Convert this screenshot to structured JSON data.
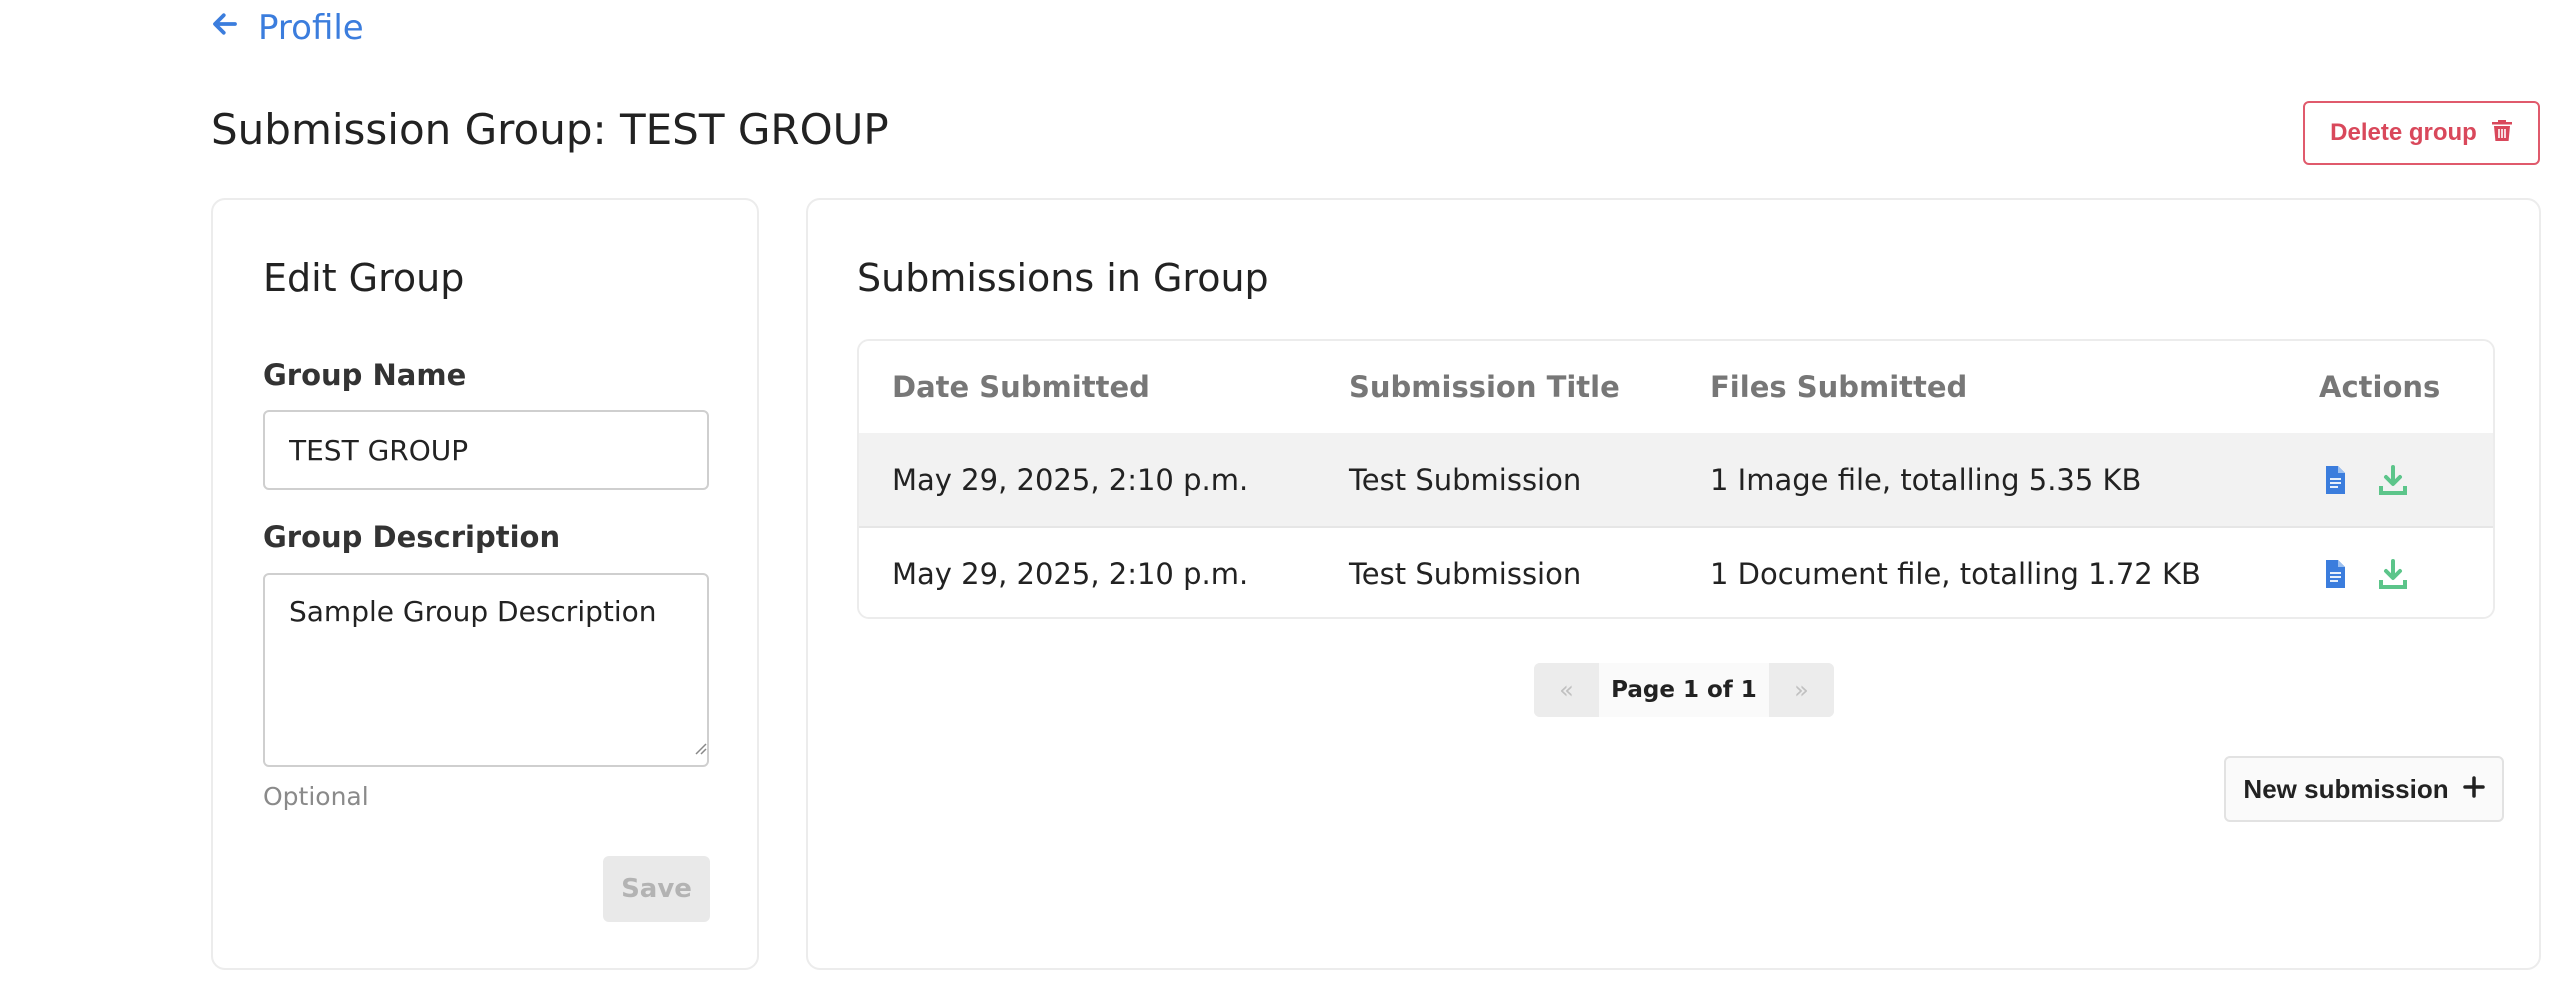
{
  "nav": {
    "back_label": "Profile"
  },
  "page": {
    "title": "Submission Group: TEST GROUP",
    "delete_label": "Delete group"
  },
  "edit_group": {
    "title": "Edit Group",
    "name_label": "Group Name",
    "name_value": "TEST GROUP",
    "description_label": "Group Description",
    "description_value": "Sample Group Description",
    "description_help": "Optional",
    "save_label": "Save"
  },
  "submissions": {
    "title": "Submissions in Group",
    "columns": [
      "Date Submitted",
      "Submission Title",
      "Files Submitted",
      "Actions"
    ],
    "rows": [
      {
        "date": "May 29, 2025, 2:10 p.m.",
        "title": "Test Submission",
        "files": "1 Image file, totalling 5.35 KB"
      },
      {
        "date": "May 29, 2025, 2:10 p.m.",
        "title": "Test Submission",
        "files": "1 Document file, totalling 1.72 KB"
      }
    ],
    "pagination": {
      "prev": "«",
      "label": "Page 1 of 1",
      "next": "»"
    },
    "new_label": "New submission"
  },
  "colors": {
    "link": "#3b7ddd",
    "danger": "#d9485b",
    "view_icon": "#3b7ddd",
    "download_icon": "#5cc58a"
  },
  "icons": {
    "back": "arrow-left-icon",
    "delete": "trash-icon",
    "view": "file-text-icon",
    "download": "download-icon",
    "add": "plus-icon"
  }
}
